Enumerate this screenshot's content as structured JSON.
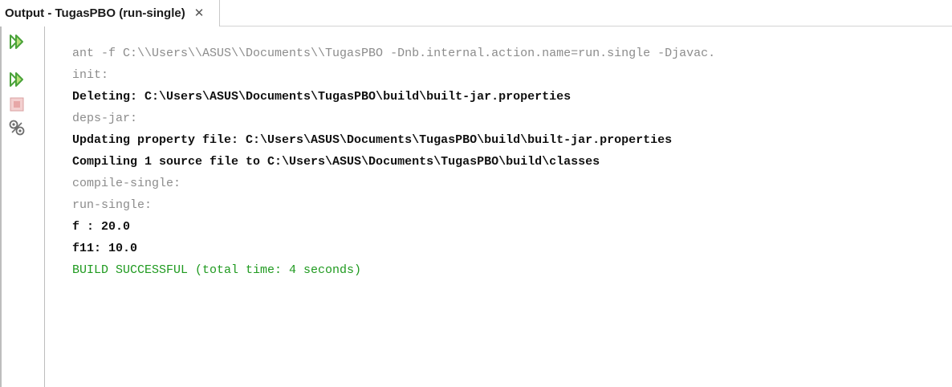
{
  "tab": {
    "title": "Output - TugasPBO (run-single)",
    "close_glyph": "✕"
  },
  "sidebar": {
    "buttons": [
      {
        "name": "rerun-icon",
        "color": "#4aa23a"
      },
      {
        "name": "rerun-with-params-icon",
        "color": "#4aa23a"
      },
      {
        "name": "stop-icon",
        "color": "#e7a7a7"
      },
      {
        "name": "settings-icon",
        "color": "#7a7a7a"
      }
    ]
  },
  "console": {
    "colors": {
      "info": "#8c8c8c",
      "normal": "#111111",
      "success": "#1f9a1f"
    },
    "lines": [
      {
        "type": "info",
        "text": "ant -f C:\\\\Users\\\\ASUS\\\\Documents\\\\TugasPBO -Dnb.internal.action.name=run.single -Djavac."
      },
      {
        "type": "info",
        "text": "init:"
      },
      {
        "type": "normal",
        "text": "Deleting: C:\\Users\\ASUS\\Documents\\TugasPBO\\build\\built-jar.properties"
      },
      {
        "type": "info",
        "text": "deps-jar:"
      },
      {
        "type": "normal",
        "text": "Updating property file: C:\\Users\\ASUS\\Documents\\TugasPBO\\build\\built-jar.properties"
      },
      {
        "type": "normal",
        "text": "Compiling 1 source file to C:\\Users\\ASUS\\Documents\\TugasPBO\\build\\classes"
      },
      {
        "type": "info",
        "text": "compile-single:"
      },
      {
        "type": "info",
        "text": "run-single:"
      },
      {
        "type": "normal",
        "text": "f : 20.0"
      },
      {
        "type": "normal",
        "text": "f11: 10.0"
      },
      {
        "type": "success",
        "text": "BUILD SUCCESSFUL (total time: 4 seconds)"
      }
    ]
  }
}
